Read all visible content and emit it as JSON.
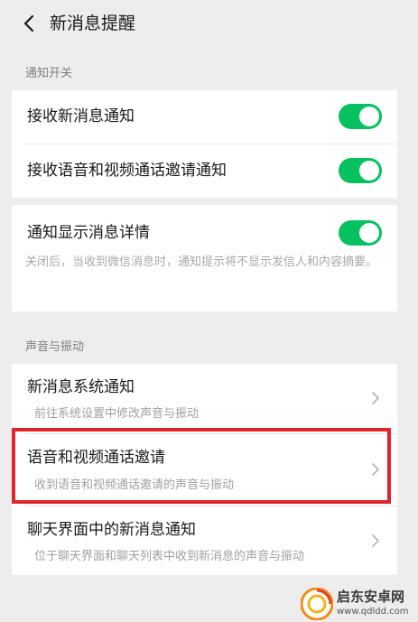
{
  "header": {
    "title": "新消息提醒",
    "back_icon": "chevron-left-icon"
  },
  "notification_switch": {
    "section_label": "通知开关",
    "receive_new_message": {
      "label": "接收新消息通知",
      "enabled": true
    },
    "receive_call_invite": {
      "label": "接收语音和视频通话邀请通知",
      "enabled": true
    }
  },
  "detail_display": {
    "label": "通知显示消息详情",
    "enabled": true,
    "description": "关闭后，当收到微信消息时，通知提示将不显示发信人和内容摘要。"
  },
  "sound_vibration": {
    "section_label": "声音与振动",
    "items": [
      {
        "title": "新消息系统通知",
        "subtitle": "前往系统设置中修改声音与振动"
      },
      {
        "title": "语音和视频通话邀请",
        "subtitle": "收到语音和视频通话邀请的声音与振动"
      },
      {
        "title": "聊天界面中的新消息通知",
        "subtitle": "位于聊天界面和聊天列表中收到新消息的声音与振动"
      }
    ]
  },
  "watermark": {
    "name": "启东安卓网",
    "url": "www.qdldd.com"
  },
  "colors": {
    "toggle_on": "#07c160",
    "highlight": "#e0242b",
    "background": "#ededed"
  }
}
